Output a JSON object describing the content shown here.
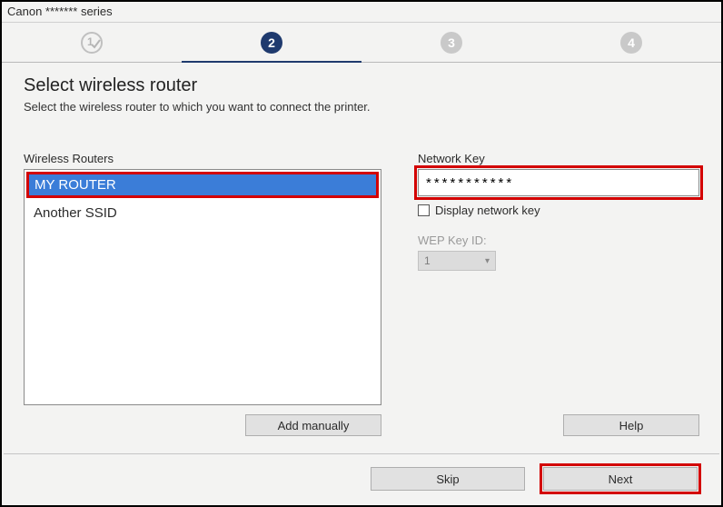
{
  "window": {
    "title": "Canon ******* series"
  },
  "stepper": {
    "step1_done": true,
    "step2_label": "2",
    "step3_label": "3",
    "step4_label": "4"
  },
  "header": {
    "title": "Select wireless router",
    "subtitle": "Select the wireless router to which you want to connect the printer."
  },
  "left": {
    "label": "Wireless Routers",
    "items": [
      "MY ROUTER",
      "Another SSID"
    ],
    "selected_index": 0,
    "add_manually_label": "Add manually"
  },
  "right": {
    "network_key_label": "Network Key",
    "network_key_value": "***********",
    "display_key_label": "Display network key",
    "display_key_checked": false,
    "wep_label": "WEP Key ID:",
    "wep_value": "1",
    "help_label": "Help"
  },
  "footer": {
    "skip_label": "Skip",
    "next_label": "Next"
  }
}
